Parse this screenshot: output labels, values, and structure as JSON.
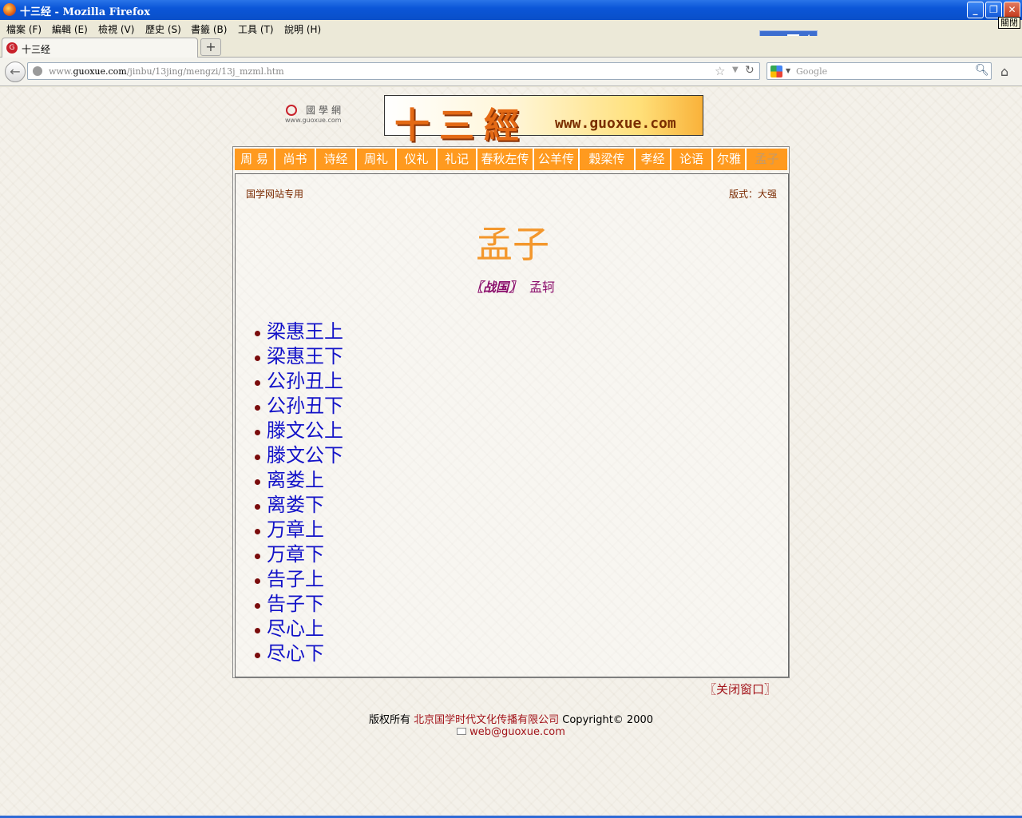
{
  "window": {
    "title": "十三经 - Mozilla Firefox",
    "close_tooltip": "關閉"
  },
  "menu": [
    "檔案 (F)",
    "編輯 (E)",
    "檢視 (V)",
    "歷史 (S)",
    "書籤 (B)",
    "工具 (T)",
    "說明 (H)"
  ],
  "tabs": [
    {
      "label": "十三经"
    }
  ],
  "new_tab_label": "+",
  "address": {
    "prefix": "www.",
    "domain": "guoxue.com",
    "path": "/jinbu/13jing/mengzi/13j_mzml.htm"
  },
  "search": {
    "placeholder": "Google"
  },
  "page": {
    "site_logo_cn": "國學網",
    "site_logo_en": "www.guoxue.com",
    "banner_title": "十三經",
    "banner_url": "www.guoxue.com",
    "nav": [
      "周 易",
      "尚书",
      "诗经",
      "周礼",
      "仪礼",
      "礼记",
      "春秋左传",
      "公羊传",
      "穀梁传",
      "孝经",
      "论语",
      "尔雅",
      "孟子"
    ],
    "active_nav": "孟子",
    "site_note": "国学网站专用",
    "format_note": "版式：大强",
    "book_title": "孟子",
    "era": "〖战国〗",
    "author": "孟轲",
    "chapters": [
      "梁惠王上",
      "梁惠王下",
      "公孙丑上",
      "公孙丑下",
      "滕文公上",
      "滕文公下",
      "离娄上",
      "离娄下",
      "万章上",
      "万章下",
      "告子上",
      "告子下",
      "尽心上",
      "尽心下"
    ],
    "close_window": "〖关闭窗口〗",
    "copyright_prefix": "版权所有",
    "company": "北京国学时代文化传播有限公司",
    "copyright_suffix": "Copyright© 2000",
    "email": "web@guoxue.com"
  },
  "colors": {
    "nav_orange": "#ff9a1f",
    "title_orange": "#f3972c",
    "link_blue": "#1212c8",
    "author_purple": "#8a0d6b",
    "footer_red": "#a3141b"
  }
}
